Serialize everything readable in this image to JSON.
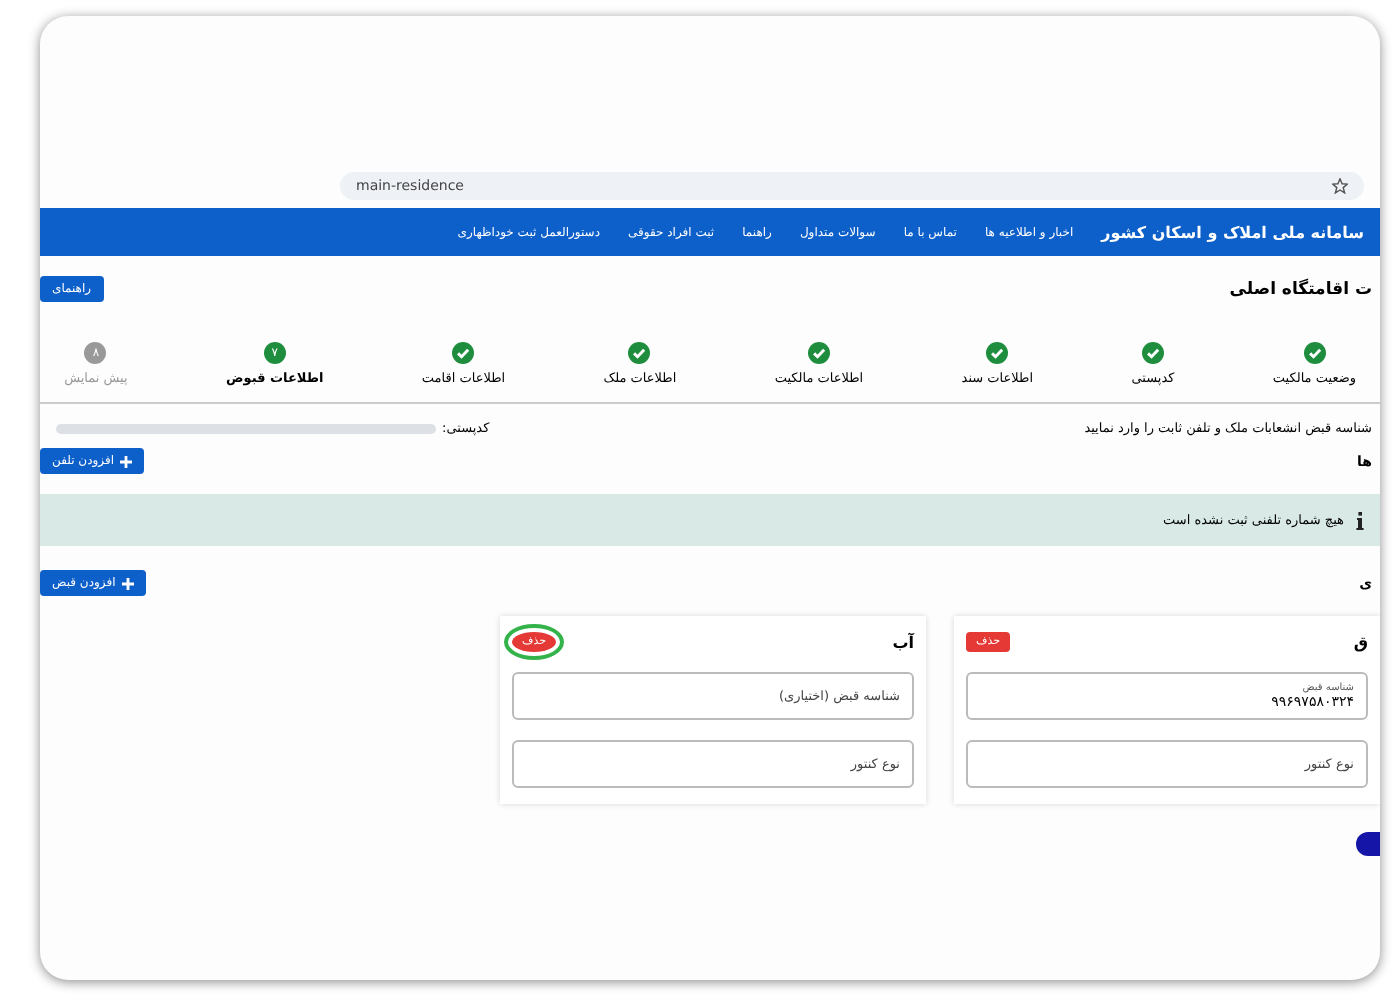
{
  "browser": {
    "url": "main-residence"
  },
  "header": {
    "title": "سامانه ملی املاک و اسکان کشور",
    "nav": [
      "اخبار و اطلاعیه ها",
      "تماس با ما",
      "سوالات متداول",
      "راهنما",
      "ثبت افراد حقوقی",
      "دستورالعمل ثبت خوداظهاری"
    ]
  },
  "page": {
    "title": "ت اقامتگاه اصلی",
    "help_button": "راهنمای"
  },
  "steps": [
    {
      "label": "وضعیت مالکیت",
      "done": true,
      "selected": false
    },
    {
      "label": "کدپستی",
      "done": true,
      "selected": false
    },
    {
      "label": "اطلاعات سند",
      "done": true,
      "selected": false
    },
    {
      "label": "اطلاعات مالکیت",
      "done": true,
      "selected": false
    },
    {
      "label": "اطلاعات ملک",
      "done": true,
      "selected": false
    },
    {
      "label": "اطلاعات اقامت",
      "done": true,
      "selected": false
    },
    {
      "label": "اطلاعات قبوض",
      "done": false,
      "selected": true,
      "number": "۷"
    },
    {
      "label": "پیش نمایش",
      "done": false,
      "selected": false,
      "number": "۸"
    }
  ],
  "instruction": "شناسه قبض انشعابات ملک و تلفن ثابت را وارد نمایید",
  "postal_label": "کدپستی:",
  "phones": {
    "heading": "ها",
    "add_button": "افزودن تلفن",
    "alert": "هیچ شماره تلفنی ثبت نشده است"
  },
  "bills": {
    "heading": "ی",
    "add_button": "افزودن قبض",
    "cards": [
      {
        "title": "ق",
        "delete_button": "حذف",
        "highlighted": false,
        "fields": [
          {
            "label": "شناسه قبض",
            "value": "۹۹۶۹۷۵۸۰۳۲۴"
          },
          {
            "placeholder": "نوع کنتور"
          }
        ]
      },
      {
        "title": "آب",
        "delete_button": "حذف",
        "highlighted": true,
        "fields": [
          {
            "placeholder": "شناسه قبض (اختیاری)"
          },
          {
            "placeholder": "نوع کنتور"
          }
        ]
      }
    ]
  }
}
